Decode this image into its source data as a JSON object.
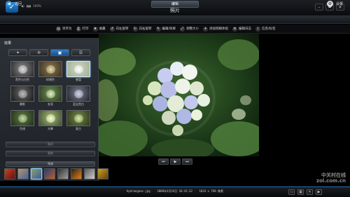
{
  "app": {
    "title_line1": "HP MediaSmart",
    "title_line2": "照片",
    "mode_label": "100%"
  },
  "nav": {
    "back_label": "返回",
    "current_tab": "编辑",
    "settings_label": "设置"
  },
  "toolbar": [
    {
      "icon": "save-as-icon",
      "glyph": "▤",
      "label": "另存为"
    },
    {
      "icon": "print-icon",
      "glyph": "⎙",
      "label": "打印"
    },
    {
      "icon": "star-icon",
      "glyph": "★",
      "label": "收藏"
    },
    {
      "icon": "rotate-left-icon",
      "glyph": "↺",
      "label": "向左旋转"
    },
    {
      "icon": "rotate-right-icon",
      "glyph": "↻",
      "label": "向右旋转"
    },
    {
      "icon": "edit-effects-icon",
      "glyph": "✎",
      "label": "编辑/效果"
    },
    {
      "icon": "resize-icon",
      "glyph": "⤢",
      "label": "调整大小"
    },
    {
      "icon": "add-to-set-icon",
      "glyph": "+",
      "label": "添加到媒体组"
    },
    {
      "icon": "edit-info-icon",
      "glyph": "≡",
      "label": "编辑日志"
    },
    {
      "icon": "info-icon",
      "glyph": "i",
      "label": "信息/标签"
    }
  ],
  "panel": {
    "title": "效果",
    "tabs": [
      {
        "icon": "wand-icon",
        "glyph": "✦"
      },
      {
        "icon": "crop-move-icon",
        "glyph": "✣"
      },
      {
        "icon": "effects-tab-icon",
        "glyph": "▣",
        "selected": true
      },
      {
        "icon": "list-icon",
        "glyph": "☰"
      }
    ],
    "effects": [
      {
        "label": "黑色与白色",
        "c1": "#888888",
        "c2": "#2a2a2a",
        "c3": "#dddddd",
        "selected": false
      },
      {
        "label": "棕褐色",
        "c1": "#8a7a50",
        "c2": "#3a3020",
        "c3": "#e8dcb0",
        "selected": false
      },
      {
        "label": "曾暂",
        "c1": "#cfd6c8",
        "c2": "#9fb090",
        "c3": "#ffffff",
        "selected": true
      },
      {
        "label": "暴影",
        "c1": "#6a6a6a",
        "c2": "#1a1a1a",
        "c3": "#bbbbbb",
        "selected": false
      },
      {
        "label": "发亮",
        "c1": "#6f8f58",
        "c2": "#2a3a20",
        "c3": "#e6f0c8",
        "selected": false
      },
      {
        "label": "蓝宝黑白",
        "c1": "#7a8090",
        "c2": "#20242e",
        "c3": "#cfd4e8",
        "selected": false
      },
      {
        "label": "色调",
        "c1": "#5f7a48",
        "c2": "#203018",
        "c3": "#c8dca8",
        "selected": false
      },
      {
        "label": "光晕",
        "c1": "#a6b878",
        "c2": "#3f5030",
        "c3": "#f4ffd8",
        "selected": false
      },
      {
        "label": "复古",
        "c1": "#76894c",
        "c2": "#2c381a",
        "c3": "#dbe8b0",
        "selected": false
      }
    ],
    "button1": "撤消",
    "button2": "重做",
    "done_label": "完成"
  },
  "playback": [
    {
      "icon": "previous-icon",
      "glyph": "⏮"
    },
    {
      "icon": "play-icon",
      "glyph": "▶"
    },
    {
      "icon": "next-icon",
      "glyph": "⏭"
    }
  ],
  "filmstrip": [
    {
      "c1": "#d04020",
      "c2": "#601010",
      "selected": false
    },
    {
      "c1": "#c09060",
      "c2": "#3a6aa8",
      "selected": false
    },
    {
      "c1": "#8aa070",
      "c2": "#405a9a",
      "selected": true
    },
    {
      "c1": "#203a8a",
      "c2": "#c06020",
      "selected": false
    },
    {
      "c1": "#303030",
      "c2": "#a0a0a0",
      "selected": false
    },
    {
      "c1": "#302010",
      "c2": "#e08020",
      "selected": false
    },
    {
      "c1": "#555555",
      "c2": "#cfcfcf",
      "selected": false
    },
    {
      "c1": "#d0a020",
      "c2": "#604010",
      "selected": false
    }
  ],
  "status": {
    "filename": "Hydrangeas.jpg",
    "datetime": "2008年3月24日  16:41:32",
    "dimensions": "1024 x 768 像素"
  },
  "bottom_icons": [
    {
      "icon": "view-fullscreen-icon",
      "glyph": "▭"
    },
    {
      "icon": "view-grid-icon",
      "glyph": "▦"
    },
    {
      "icon": "close-view-icon",
      "glyph": "✕"
    },
    {
      "icon": "slideshow-icon",
      "glyph": "▶"
    }
  ],
  "watermark": {
    "line1": "中关村在线",
    "line2": "zol.com.cn"
  },
  "colors": {
    "accent": "#2a8ad0",
    "panel": "#2c3138"
  }
}
